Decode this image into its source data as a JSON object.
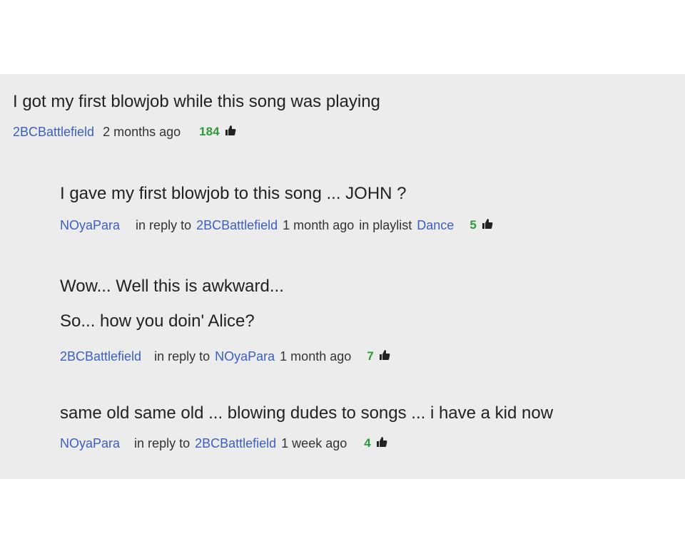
{
  "comments": [
    {
      "text": "I got my first blowjob while this song was playing",
      "author": "2BCBattlefield",
      "time": "2 months ago",
      "likes": "184",
      "icon": "thumbs-up-icon"
    },
    {
      "text": "I gave my first blowjob to this song ... JOHN ?",
      "author": "NOyaPara",
      "reply_prefix": "in reply to",
      "reply_to": "2BCBattlefield",
      "time": "1 month ago",
      "playlist_prefix": "in playlist",
      "playlist": "Dance",
      "likes": "5",
      "icon": "thumbs-up-icon"
    },
    {
      "text_lines": [
        "Wow... Well this is awkward...",
        "So... how you doin' Alice?"
      ],
      "author": "2BCBattlefield",
      "reply_prefix": "in reply to",
      "reply_to": "NOyaPara",
      "time": "1 month ago",
      "likes": "7",
      "icon": "thumbs-up-icon"
    },
    {
      "text": "same old same old ... blowing dudes to songs ... i have a kid now",
      "author": "NOyaPara",
      "reply_prefix": "in reply to",
      "reply_to": "2BCBattlefield",
      "time": "1 week ago",
      "likes": "4",
      "icon": "thumbs-up-icon"
    }
  ],
  "colors": {
    "author_link": "#3b5fc2",
    "likes": "#2f9a3a",
    "panel_background": "#ececec",
    "comment_text": "#222222"
  }
}
